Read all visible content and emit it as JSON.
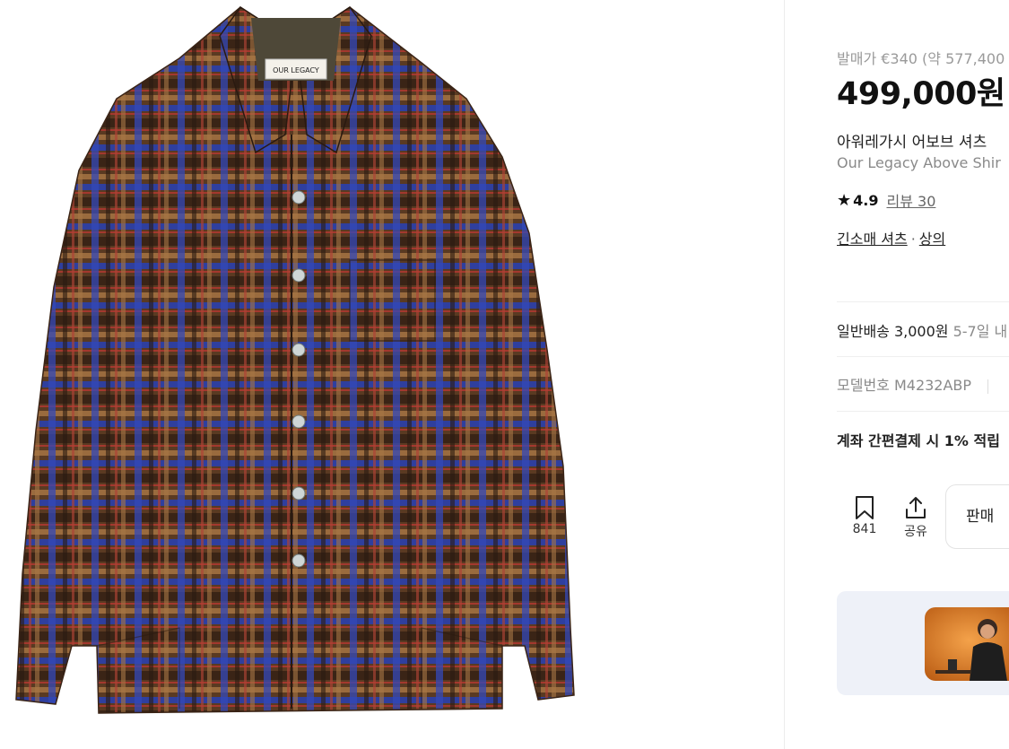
{
  "product": {
    "release_price": "발매가 €340 (약 577,400",
    "price": "499,000원",
    "name_ko": "아워레가시 어보브 셔츠",
    "name_en": "Our Legacy Above Shir",
    "image_alt": "Our Legacy Above Shirt",
    "label_text": "OUR LEGACY"
  },
  "rating": {
    "score": "4.9",
    "review_label": "리뷰 30"
  },
  "categories": {
    "primary": "긴소매 셔츠",
    "separator": "·",
    "secondary": "상의"
  },
  "shipping": {
    "label": "일반배송 3,000원",
    "days": "5-7일 내"
  },
  "model": {
    "text": "모델번호 M4232ABP"
  },
  "benefit": {
    "text": "계좌 간편결제 시 1% 적립"
  },
  "actions": {
    "bookmark_count": "841",
    "share_label": "공유",
    "sell_label": "판매"
  },
  "colors": {
    "shirt_brown": "#5a3a22",
    "shirt_blue": "#3a4fc0",
    "banner_bg": "#eef1f8"
  }
}
